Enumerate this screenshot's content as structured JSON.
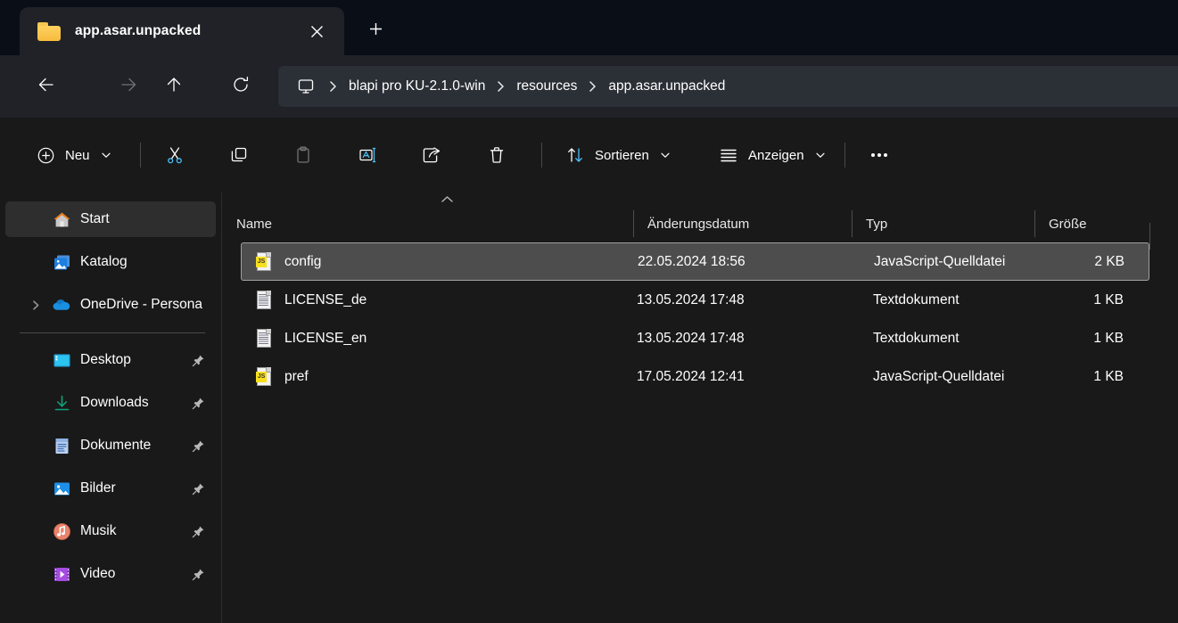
{
  "window": {
    "tab": {
      "title": "app.asar.unpacked",
      "folder_icon": "folder-icon",
      "close_icon": "close-icon"
    },
    "new_tab_label": "+",
    "new_tab_icon": "plus-icon"
  },
  "nav": {
    "back_icon": "arrow-left-icon",
    "forward_icon": "arrow-right-icon",
    "up_icon": "arrow-up-icon",
    "refresh_icon": "refresh-icon",
    "breadcrumb": {
      "root_icon": "monitor-icon",
      "separator": "›",
      "items": [
        {
          "label": "blapi pro KU-2.1.0-win"
        },
        {
          "label": "resources"
        },
        {
          "label": "app.asar.unpacked"
        }
      ]
    }
  },
  "toolbar": {
    "new_label": "Neu",
    "new_icon": "plus-circle-icon",
    "cut_icon": "scissors-icon",
    "copy_icon": "copy-icon",
    "paste_icon": "paste-icon",
    "rename_icon": "rename-icon",
    "share_icon": "share-icon",
    "delete_icon": "trash-icon",
    "sort_label": "Sortieren",
    "sort_icon": "sort-arrows-icon",
    "view_label": "Anzeigen",
    "view_icon": "list-lines-icon",
    "more_label": "•••",
    "more_icon": "ellipsis-icon",
    "chevron_icon": "chevron-down-icon"
  },
  "sidebar": {
    "items": [
      {
        "label": "Start",
        "icon": "home-icon",
        "selected": true,
        "pinned": false,
        "expandable": false
      },
      {
        "label": "Katalog",
        "icon": "gallery-icon",
        "selected": false,
        "pinned": false,
        "expandable": false
      },
      {
        "label": "OneDrive - Persona",
        "icon": "onedrive-icon",
        "selected": false,
        "pinned": false,
        "expandable": true
      },
      {
        "label": "Desktop",
        "icon": "desktop-icon",
        "selected": false,
        "pinned": true,
        "expandable": false
      },
      {
        "label": "Downloads",
        "icon": "download-icon",
        "selected": false,
        "pinned": true,
        "expandable": false
      },
      {
        "label": "Dokumente",
        "icon": "document-icon",
        "selected": false,
        "pinned": true,
        "expandable": false
      },
      {
        "label": "Bilder",
        "icon": "pictures-icon",
        "selected": false,
        "pinned": true,
        "expandable": false
      },
      {
        "label": "Musik",
        "icon": "music-icon",
        "selected": false,
        "pinned": true,
        "expandable": false
      },
      {
        "label": "Video",
        "icon": "video-icon",
        "selected": false,
        "pinned": true,
        "expandable": false
      }
    ]
  },
  "filelist": {
    "sort_indicator": "ascending",
    "columns": {
      "name": "Name",
      "date": "Änderungsdatum",
      "type": "Typ",
      "size": "Größe"
    },
    "rows": [
      {
        "name": "config",
        "date": "22.05.2024 18:56",
        "type": "JavaScript-Quelldatei",
        "size": "2 KB",
        "icon": "js-file-icon",
        "selected": true
      },
      {
        "name": "LICENSE_de",
        "date": "13.05.2024 17:48",
        "type": "Textdokument",
        "size": "1 KB",
        "icon": "text-file-icon",
        "selected": false
      },
      {
        "name": "LICENSE_en",
        "date": "13.05.2024 17:48",
        "type": "Textdokument",
        "size": "1 KB",
        "icon": "text-file-icon",
        "selected": false
      },
      {
        "name": "pref",
        "date": "17.05.2024 12:41",
        "type": "JavaScript-Quelldatei",
        "size": "1 KB",
        "icon": "js-file-icon",
        "selected": false
      }
    ]
  },
  "colors": {
    "titlebar_bg": "#0a0e17",
    "chrome_bg": "#202227",
    "content_bg": "#191919",
    "selection_bg": "#4d4d4d",
    "accent": "#4cc2ff",
    "folder_yellow": "#f7c651"
  }
}
